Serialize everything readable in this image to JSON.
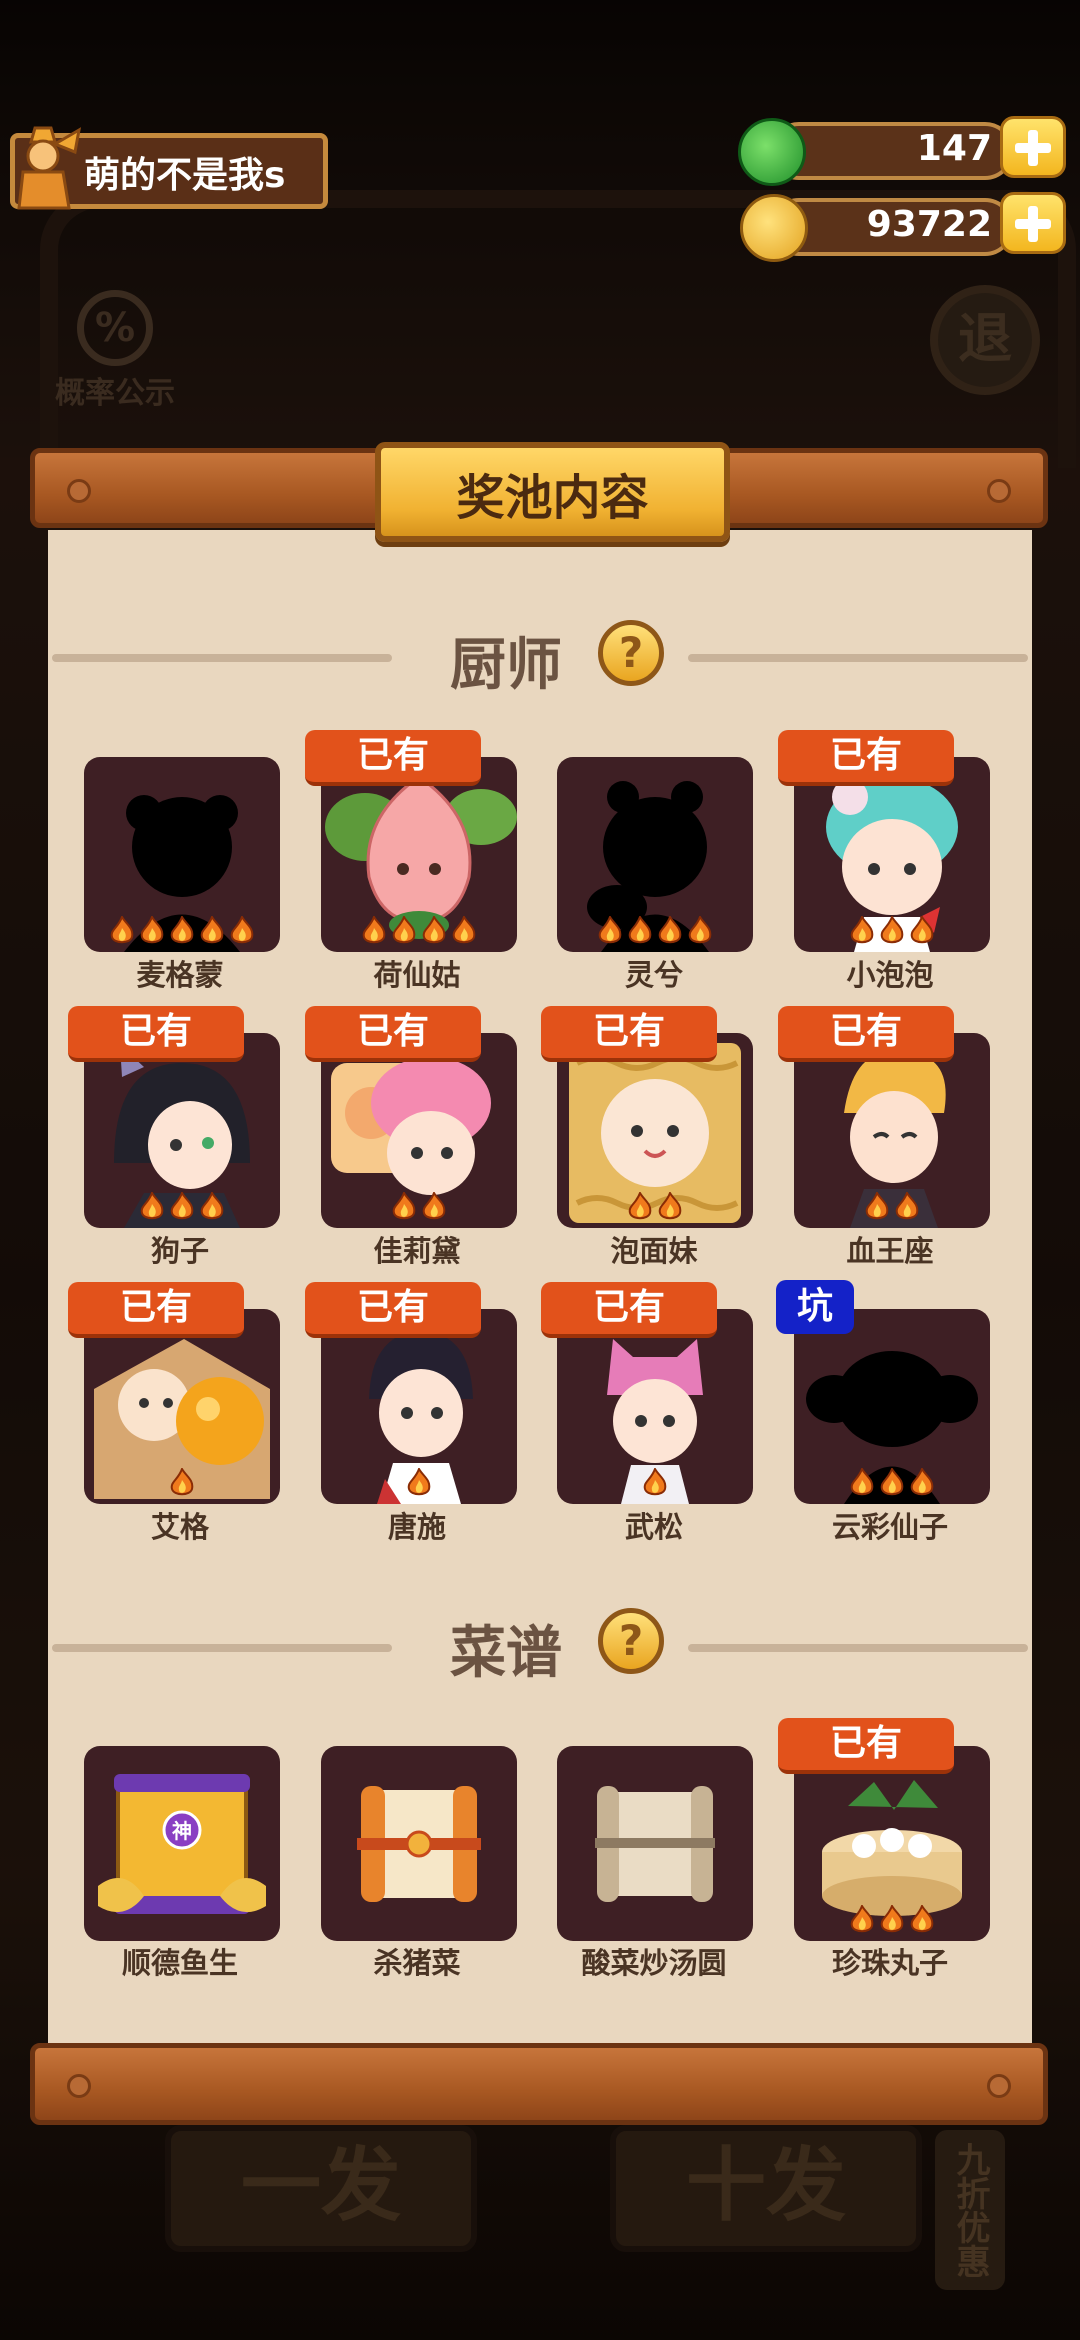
{
  "user": {
    "name": "萌的不是我s"
  },
  "resources": {
    "jade": "147",
    "coins": "93722"
  },
  "background": {
    "prob_symbol": "%",
    "prob_label": "概率公示",
    "exit_label": "退",
    "single_draw": "一发",
    "ten_draw": "十发",
    "discount": "九折优惠"
  },
  "modal": {
    "title": "奖池内容"
  },
  "chefs": {
    "section_title": "厨师",
    "items": [
      {
        "name": "麦格蒙",
        "owned": false,
        "stars": 5,
        "silhouette": true
      },
      {
        "name": "荷仙姑",
        "owned": true,
        "stars": 4,
        "silhouette": false
      },
      {
        "name": "灵兮",
        "owned": false,
        "stars": 4,
        "silhouette": true
      },
      {
        "name": "小泡泡",
        "owned": true,
        "stars": 3,
        "silhouette": false
      },
      {
        "name": "狗子",
        "owned": true,
        "stars": 3,
        "silhouette": false
      },
      {
        "name": "佳莉黛",
        "owned": true,
        "stars": 2,
        "silhouette": false
      },
      {
        "name": "泡面妹",
        "owned": true,
        "stars": 2,
        "silhouette": false
      },
      {
        "name": "血王座",
        "owned": true,
        "stars": 2,
        "silhouette": false
      },
      {
        "name": "艾格",
        "owned": true,
        "stars": 1,
        "silhouette": false
      },
      {
        "name": "唐施",
        "owned": true,
        "stars": 1,
        "silhouette": false
      },
      {
        "name": "武松",
        "owned": true,
        "stars": 1,
        "silhouette": false
      },
      {
        "name": "云彩仙子",
        "owned": false,
        "stars": 3,
        "silhouette": true
      }
    ]
  },
  "recipes": {
    "section_title": "菜谱",
    "items": [
      {
        "name": "顺德鱼生",
        "owned": false,
        "stars": 0
      },
      {
        "name": "杀猪菜",
        "owned": false,
        "stars": 0
      },
      {
        "name": "酸菜炒汤圆",
        "owned": false,
        "stars": 0
      },
      {
        "name": "珍珠丸子",
        "owned": true,
        "stars": 3
      }
    ]
  },
  "labels": {
    "owned": "已有",
    "pit": "坑",
    "god_mark": "神",
    "help": "?"
  }
}
